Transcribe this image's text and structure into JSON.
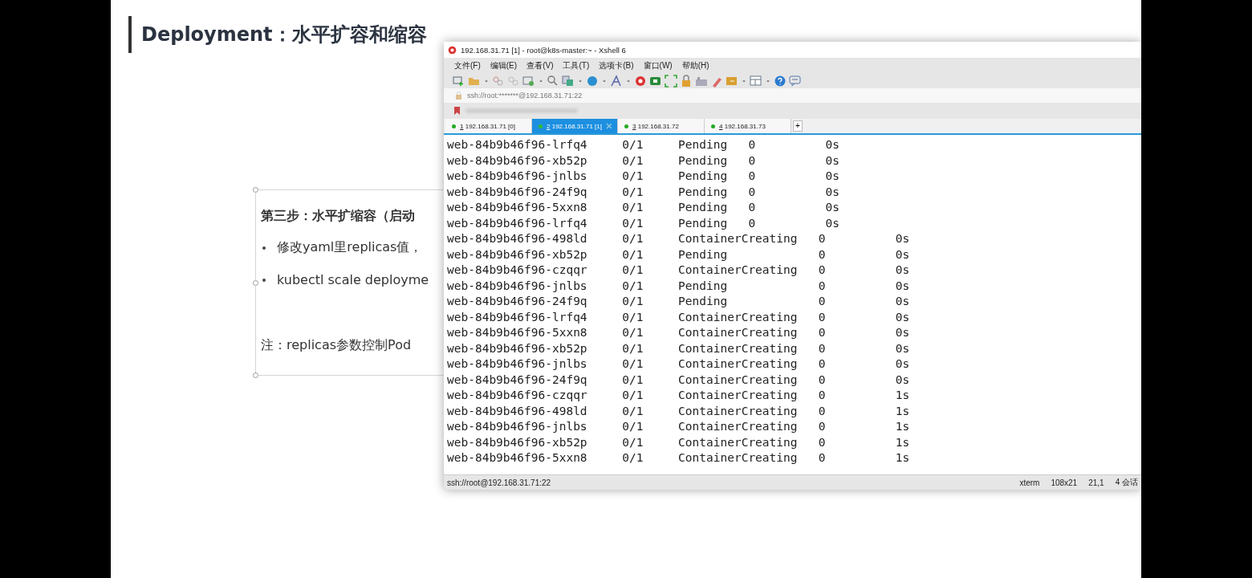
{
  "slide": {
    "title": "Deployment：水平扩容和缩容",
    "text_box": {
      "heading": "第三步：水平扩缩容（启动",
      "bullets": [
        "修改yaml里replicas值，",
        "kubectl scale deployme"
      ],
      "note": "注：replicas参数控制Pod"
    }
  },
  "window": {
    "title": "192.168.31.71 [1] - root@k8s-master:~ - Xshell 6",
    "menu": [
      "文件(F)",
      "编辑(E)",
      "查看(V)",
      "工具(T)",
      "选项卡(B)",
      "窗口(W)",
      "帮助(H)"
    ],
    "address": "ssh://root:*******@192.168.31.71:22",
    "tabs": [
      {
        "number": "1",
        "label": "192.168.31.71 [0]",
        "selected": false
      },
      {
        "number": "2",
        "label": "192.168.31.71 [1]",
        "selected": true
      },
      {
        "number": "3",
        "label": "192.168.31.72",
        "selected": false
      },
      {
        "number": "4",
        "label": "192.168.31.73",
        "selected": false
      }
    ],
    "new_tab": "+",
    "terminal_lines": [
      "web-84b9b46f96-lrfq4     0/1     Pending   0          0s",
      "web-84b9b46f96-xb52p     0/1     Pending   0          0s",
      "web-84b9b46f96-jnlbs     0/1     Pending   0          0s",
      "web-84b9b46f96-24f9q     0/1     Pending   0          0s",
      "web-84b9b46f96-5xxn8     0/1     Pending   0          0s",
      "web-84b9b46f96-lrfq4     0/1     Pending   0          0s",
      "web-84b9b46f96-498ld     0/1     ContainerCreating   0          0s",
      "web-84b9b46f96-xb52p     0/1     Pending             0          0s",
      "web-84b9b46f96-czqqr     0/1     ContainerCreating   0          0s",
      "web-84b9b46f96-jnlbs     0/1     Pending             0          0s",
      "web-84b9b46f96-24f9q     0/1     Pending             0          0s",
      "web-84b9b46f96-lrfq4     0/1     ContainerCreating   0          0s",
      "web-84b9b46f96-5xxn8     0/1     ContainerCreating   0          0s",
      "web-84b9b46f96-xb52p     0/1     ContainerCreating   0          0s",
      "web-84b9b46f96-jnlbs     0/1     ContainerCreating   0          0s",
      "web-84b9b46f96-24f9q     0/1     ContainerCreating   0          0s",
      "web-84b9b46f96-czqqr     0/1     ContainerCreating   0          1s",
      "web-84b9b46f96-498ld     0/1     ContainerCreating   0          1s",
      "web-84b9b46f96-jnlbs     0/1     ContainerCreating   0          1s",
      "web-84b9b46f96-xb52p     0/1     ContainerCreating   0          1s",
      "web-84b9b46f96-5xxn8     0/1     ContainerCreating   0          1s"
    ],
    "status_bar": {
      "connection": "ssh://root@192.168.31.71:22",
      "terminal_type": "xterm",
      "size": "108x21",
      "cursor": "21,1",
      "sessions": "4 会话"
    }
  }
}
